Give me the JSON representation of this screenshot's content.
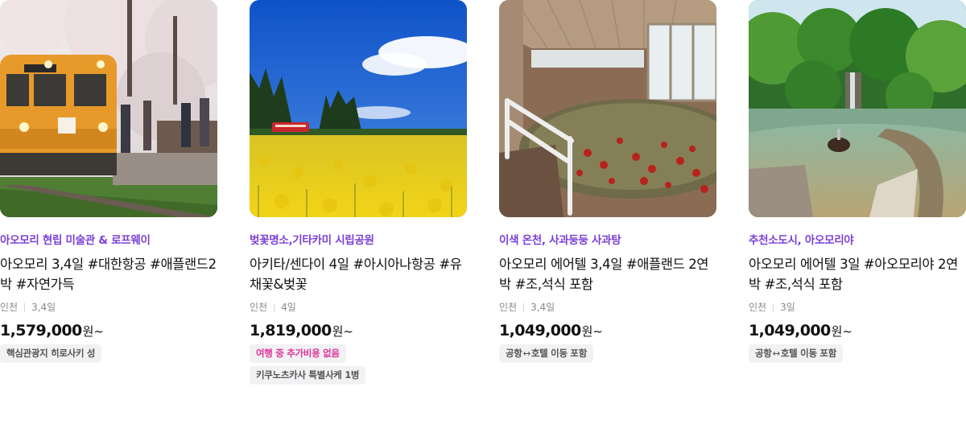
{
  "products": [
    {
      "image_alt": "orange train passing cherry blossoms",
      "subtitle": "아오모리 현립 미술관 & 로프웨이",
      "title": "아오모리 3,4일 #대한항공 #애플랜드2박 #자연가득",
      "departure": "인천",
      "duration": "3,4일",
      "price": "1,579,000",
      "currency": "원~",
      "tags": [
        {
          "text": "핵심관광지 히로사키 성",
          "color": "#555555"
        }
      ]
    },
    {
      "image_alt": "yellow rapeseed flower field with red train",
      "subtitle": "벚꽃명소,기타카미 시립공원",
      "title": "아키타/센다이 4일 #아시아나항공 #유채꽃&벚꽃",
      "departure": "인천",
      "duration": "4일",
      "price": "1,819,000",
      "currency": "원~",
      "tags": [
        {
          "text": "여행 중 추가비용 없음",
          "color": "#e0339b"
        },
        {
          "text": "키쿠노츠카사 특별사케 1병",
          "color": "#555555"
        }
      ]
    },
    {
      "image_alt": "indoor hot spring bath with floating apples",
      "subtitle": "이색 온천, 사과둥둥 사과탕",
      "title": "아오모리 에어텔 3,4일 #애플랜드 2연박 #조,석식 포함",
      "departure": "인천",
      "duration": "3,4일",
      "price": "1,049,000",
      "currency": "원~",
      "tags": [
        {
          "text_before": "공항",
          "arrow": "↔",
          "text_after": "호텔 이동 포함",
          "color": "#555555"
        }
      ]
    },
    {
      "image_alt": "outdoor hot spring surrounded by forest",
      "subtitle": "추천소도시, 아오모리야",
      "title": "아오모리 에어텔 3일 #아오모리야 2연박 #조,석식 포함",
      "departure": "인천",
      "duration": "3일",
      "price": "1,049,000",
      "currency": "원~",
      "tags": [
        {
          "text_before": "공항",
          "arrow": "↔",
          "text_after": "호텔 이동 포함",
          "color": "#555555"
        }
      ]
    }
  ],
  "colors": {
    "subtitle": "#7b3fd6",
    "tag_bg": "#f2f2f4",
    "tag_highlight": "#e0339b",
    "price": "#111111"
  }
}
